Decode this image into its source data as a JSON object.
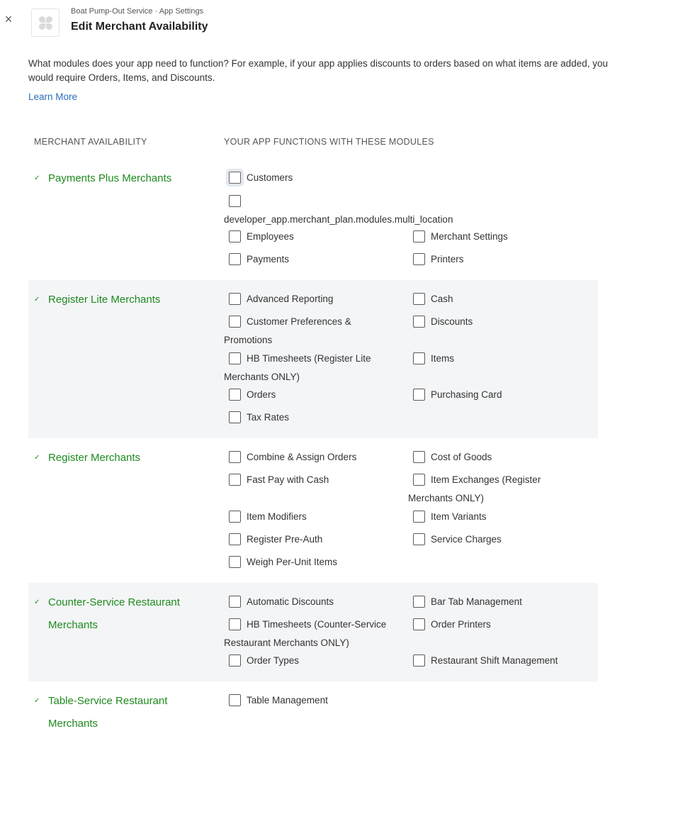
{
  "header": {
    "close_icon": "×",
    "breadcrumb": "Boat Pump-Out Service · App Settings",
    "title": "Edit Merchant Availability"
  },
  "intro": {
    "text": "What modules does your app need to function? For example, if your app applies discounts to orders based on what items are added, you would require Orders, Items, and Discounts.",
    "learn_more": "Learn More"
  },
  "columns": {
    "availability": "MERCHANT AVAILABILITY",
    "modules": "YOUR APP FUNCTIONS WITH THESE MODULES"
  },
  "check_glyph": "✓",
  "sections": [
    {
      "title": "Payments Plus Merchants",
      "modules": [
        "Customers",
        "developer_app.merchant_plan.modules.multi_location",
        "Employees",
        "Merchant Settings",
        "Payments",
        "Printers"
      ]
    },
    {
      "title": "Register Lite Merchants",
      "modules": [
        "Advanced Reporting",
        "Cash",
        "Customer Preferences & Promotions",
        "Discounts",
        "HB Timesheets (Register Lite Merchants ONLY)",
        "Items",
        "Orders",
        "Purchasing Card",
        "Tax Rates"
      ]
    },
    {
      "title": "Register Merchants",
      "modules": [
        "Combine & Assign Orders",
        "Cost of Goods",
        "Fast Pay with Cash",
        "Item Exchanges (Register Merchants ONLY)",
        "Item Modifiers",
        "Item Variants",
        "Register Pre-Auth",
        "Service Charges",
        "Weigh Per-Unit Items"
      ]
    },
    {
      "title": "Counter-Service Restaurant Merchants",
      "modules": [
        "Automatic Discounts",
        "Bar Tab Management",
        "HB Timesheets (Counter-Service Restaurant Merchants ONLY)",
        "Order Printers",
        "Order Types",
        "Restaurant Shift Management"
      ]
    },
    {
      "title": "Table-Service Restaurant Merchants",
      "modules": [
        "Table Management"
      ]
    }
  ]
}
